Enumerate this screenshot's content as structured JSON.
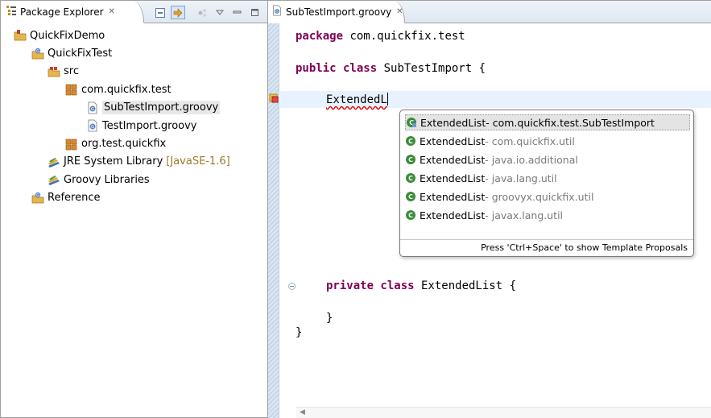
{
  "explorer": {
    "tab_title": "Package Explorer",
    "tab_close": "✕",
    "tree": [
      {
        "label": "QuickFixDemo",
        "icon": "project-icon"
      },
      {
        "label": "QuickFixTest",
        "icon": "groovy-project-icon"
      },
      {
        "label": "src",
        "icon": "source-folder-icon"
      },
      {
        "label": "com.quickfix.test",
        "icon": "package-icon"
      },
      {
        "label": "SubTestImport.groovy",
        "icon": "groovy-file-icon"
      },
      {
        "label": "TestImport.groovy",
        "icon": "groovy-file-icon"
      },
      {
        "label": "org.test.quickfix",
        "icon": "package-icon"
      },
      {
        "label": "JRE System Library",
        "decoration": "[JavaSE-1.6]",
        "icon": "library-icon"
      },
      {
        "label": "Groovy Libraries",
        "icon": "library-icon"
      },
      {
        "label": "Reference",
        "icon": "groovy-project-icon"
      }
    ]
  },
  "editor": {
    "tab_title": "SubTestImport.groovy",
    "tab_close": "✕",
    "code": {
      "line1_kw": "package",
      "line1_rest": " com.quickfix.test",
      "line2_kw": "public class",
      "line2_rest": " SubTestImport {",
      "line3_typed": "ExtendedL",
      "line4_kw": "private class",
      "line4_rest": " ExtendedList {",
      "line5": "}",
      "line6": "}"
    }
  },
  "content_assist": {
    "proposals": [
      {
        "name": "ExtendedList",
        "qualifier": " - com.quickfix.test.SubTestImport"
      },
      {
        "name": "ExtendedList",
        "qualifier": " - com.quickfix.util"
      },
      {
        "name": "ExtendedList",
        "qualifier": " - java.io.additional"
      },
      {
        "name": "ExtendedList",
        "qualifier": " - java.lang.util"
      },
      {
        "name": "ExtendedList",
        "qualifier": " - groovyx.quickfix.util"
      },
      {
        "name": "ExtendedList",
        "qualifier": " - javax.lang.util"
      }
    ],
    "footer": "Press 'Ctrl+Space' to show Template Proposals"
  },
  "colors": {
    "keyword": "#7f0055",
    "selection": "#e4e4e4",
    "current_line": "#e8f2fe",
    "error": "#e00000"
  }
}
